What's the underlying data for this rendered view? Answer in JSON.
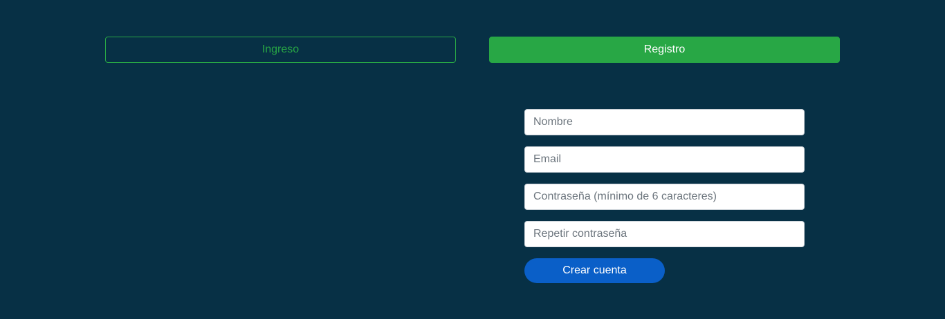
{
  "tabs": {
    "login_label": "Ingreso",
    "register_label": "Registro"
  },
  "form": {
    "name_placeholder": "Nombre",
    "email_placeholder": "Email",
    "password_placeholder": "Contraseña (mínimo de 6 caracteres)",
    "repeat_password_placeholder": "Repetir contraseña",
    "submit_label": "Crear cuenta"
  },
  "colors": {
    "background": "#073045",
    "accent_green": "#28a745",
    "submit_blue": "#0a5fc8"
  }
}
